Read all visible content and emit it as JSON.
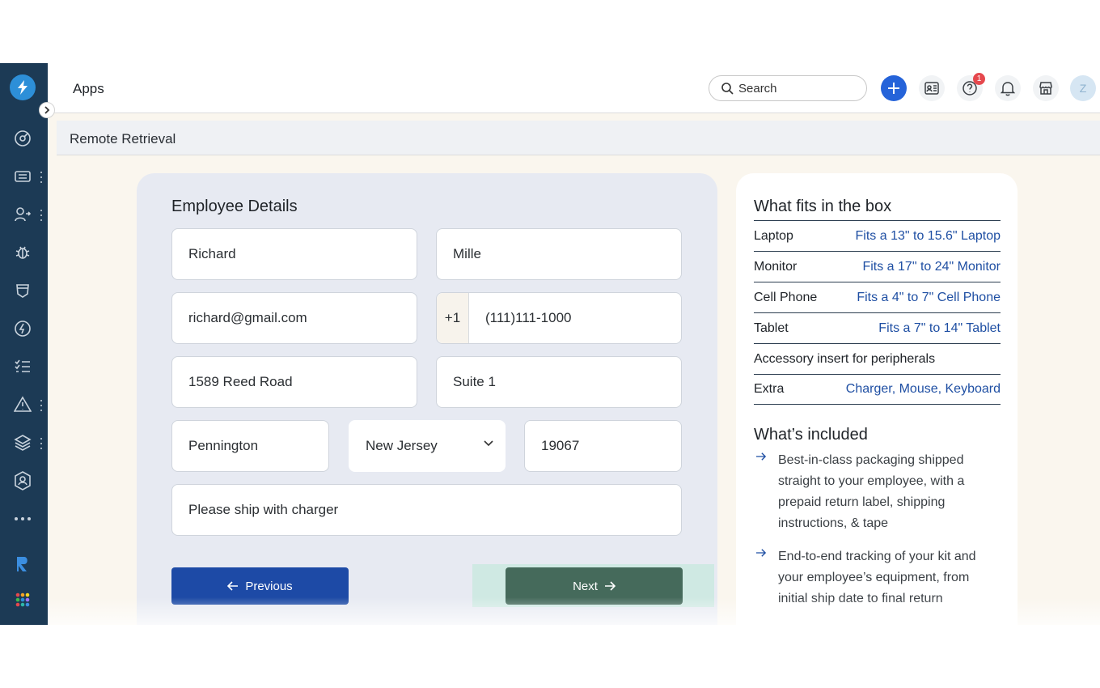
{
  "header": {
    "title": "Apps",
    "search_placeholder": "Search",
    "notification_count": "1",
    "avatar_initial": "Z"
  },
  "breadcrumb": "Remote Retrieval",
  "form": {
    "title": "Employee Details",
    "first_name": "Richard",
    "last_name": "Mille",
    "email": "richard@gmail.com",
    "phone_prefix": "+1",
    "phone": "(111)111-1000",
    "address1": "1589 Reed Road",
    "address2": "Suite 1",
    "city": "Pennington",
    "state": "New Jersey",
    "zip": "19067",
    "note": "Please ship with charger",
    "prev_label": "Previous",
    "next_label": "Next"
  },
  "info": {
    "box_title": "What fits in the box",
    "specs": [
      {
        "label": "Laptop",
        "value": "Fits a 13\" to 15.6\" Laptop"
      },
      {
        "label": "Monitor",
        "value": "Fits a 17\" to 24\" Monitor"
      },
      {
        "label": "Cell Phone",
        "value": "Fits a 4\" to 7\" Cell Phone"
      },
      {
        "label": "Tablet",
        "value": "Fits a 7\" to 14\" Tablet"
      },
      {
        "label": "Accessory insert for peripherals",
        "value": ""
      },
      {
        "label": "Extra",
        "value": "Charger, Mouse, Keyboard"
      }
    ],
    "included_title": "What’s included",
    "included": [
      "Best-in-class packaging shipped straight to your employee, with a prepaid return label, shipping instructions, & tape",
      "End-to-end tracking of your kit and your employee’s equipment, from initial ship date to final return"
    ]
  },
  "colors": {
    "sidebar": "#1c3a55",
    "primary_button": "#1d4aa6",
    "next_button": "#456a5b",
    "link": "#1f4fa3"
  }
}
